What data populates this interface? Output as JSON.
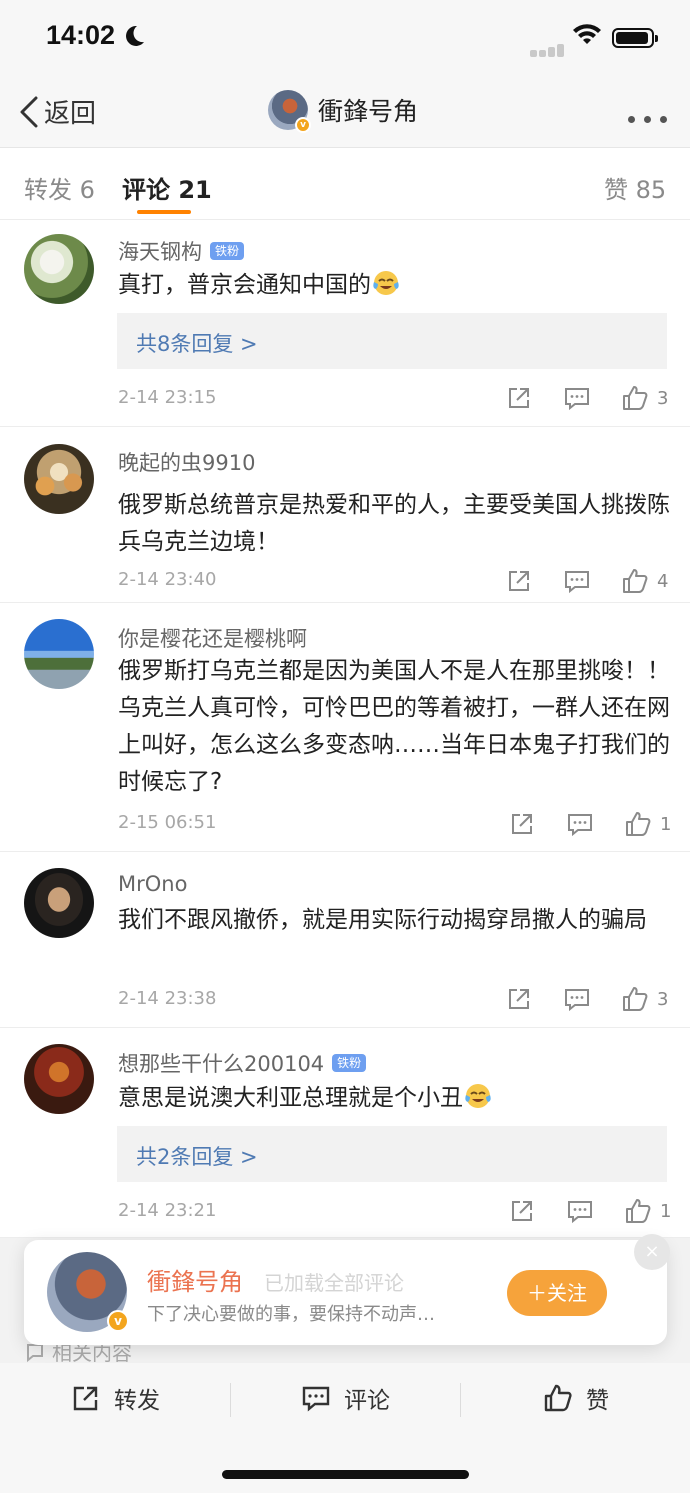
{
  "status": {
    "time": "14:02"
  },
  "nav": {
    "back_label": "返回",
    "title": "衝鋒号角"
  },
  "tabs": [
    {
      "label": "转发 6"
    },
    {
      "label": "评论 21"
    },
    {
      "label": "赞 85"
    }
  ],
  "comments": [
    {
      "name": "海天钢构",
      "badge": "铁粉",
      "text": "真打，普京会通知中国的",
      "emoji": "crying-laughing-emoji",
      "replies": "共8条回复 >",
      "time": "2-14 23:15",
      "likes": "3"
    },
    {
      "name": "晚起的虫9910",
      "text": "俄罗斯总统普京是热爱和平的人，主要受美国人挑拨陈兵乌克兰边境！",
      "time": "2-14 23:40",
      "likes": "4"
    },
    {
      "name": "你是樱花还是樱桃啊",
      "text": "俄罗斯打乌克兰都是因为美国人不是人在那里挑唆！！乌克兰人真可怜，可怜巴巴的等着被打，一群人还在网上叫好，怎么这么多变态呐……当年日本鬼子打我们的时候忘了?",
      "time": "2-15 06:51",
      "likes": "1"
    },
    {
      "name": "MrOno",
      "text": "我们不跟风撤侨，就是用实际行动揭穿昂撒人的骗局",
      "time": "2-14 23:38",
      "likes": "3"
    },
    {
      "name": "想那些干什么200104",
      "badge": "铁粉",
      "text": "意思是说澳大利亚总理就是个小丑",
      "emoji": "crying-laughing-emoji",
      "replies": "共2条回复 >",
      "time": "2-14 23:21",
      "likes": "1"
    }
  ],
  "follow_card": {
    "name": "衝鋒号角",
    "ghost_text": "已加载全部评论",
    "desc": "下了决心要做的事，要保持不动声…",
    "button": "＋关注",
    "close": "×"
  },
  "related": "相关内容",
  "toolbar": {
    "repost": "转发",
    "comment": "评论",
    "like": "赞"
  },
  "colors": {
    "accent": "#ff8200",
    "link": "#4f7ab3",
    "follow": "#f6a33b"
  }
}
